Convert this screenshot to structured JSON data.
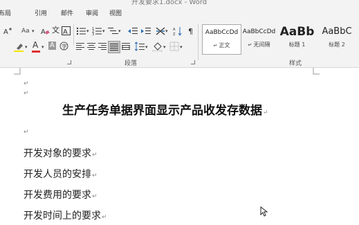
{
  "window": {
    "title": "开发要求1.docx - Word"
  },
  "tabs": [
    "布局",
    "引用",
    "邮件",
    "审阅",
    "视图"
  ],
  "ribbon": {
    "font_size_label": "Aa",
    "text_effect_label": "A",
    "font_color_label": "A",
    "char_shading_label": "A",
    "groups": {
      "paragraph": "段落",
      "styles": "样式"
    },
    "styles": [
      {
        "preview": "AaBbCcDd",
        "name": "正文",
        "selected": true
      },
      {
        "preview": "AaBbCcDd",
        "name": "无间隔",
        "selected": false
      },
      {
        "preview": "AaBb",
        "name": "标题 1",
        "selected": false
      },
      {
        "preview": "AaBbC",
        "name": "标题 2",
        "selected": false
      }
    ]
  },
  "document": {
    "paragraph_mark": "↵",
    "title": "生产任务单据界面显示产品收发存数据",
    "paragraphs": [
      "开发对象的要求",
      "开发人员的安排",
      "开发费用的要求",
      "开发时间上的要求"
    ]
  },
  "colors": {
    "font_color_underline": "#e03030",
    "highlight_underline": "#f4e400"
  }
}
